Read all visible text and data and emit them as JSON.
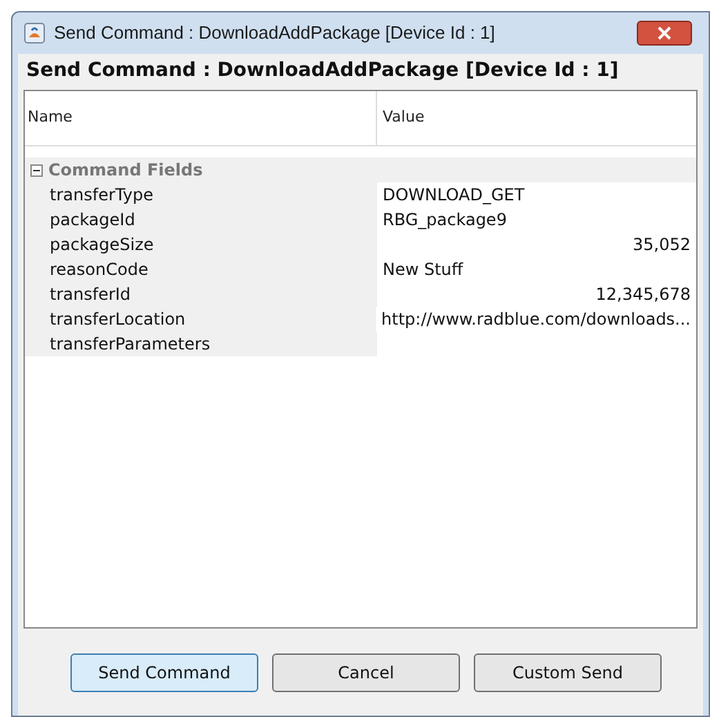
{
  "window": {
    "title": "Send Command : DownloadAddPackage [Device Id : 1]"
  },
  "heading": "Send Command : DownloadAddPackage [Device Id : 1]",
  "table": {
    "columns": [
      "Name",
      "Value"
    ],
    "groups": [
      {
        "label": "Command Fields",
        "expanded": true,
        "rows": [
          {
            "name": "transferType",
            "value": "DOWNLOAD_GET",
            "kind": "text"
          },
          {
            "name": "packageId",
            "value": "RBG_package9",
            "kind": "text"
          },
          {
            "name": "packageSize",
            "value": "35,052",
            "kind": "number"
          },
          {
            "name": "reasonCode",
            "value": "New Stuff",
            "kind": "text"
          },
          {
            "name": "transferId",
            "value": "12,345,678",
            "kind": "number"
          },
          {
            "name": "transferLocation",
            "value": "http://www.radblue.com/downloads...",
            "kind": "text"
          },
          {
            "name": "transferParameters",
            "kind": "text"
          }
        ]
      }
    ]
  },
  "buttons": [
    {
      "label": "Send Command",
      "default": true
    },
    {
      "label": "Cancel",
      "default": false
    },
    {
      "label": "Custom Send",
      "default": false
    }
  ]
}
